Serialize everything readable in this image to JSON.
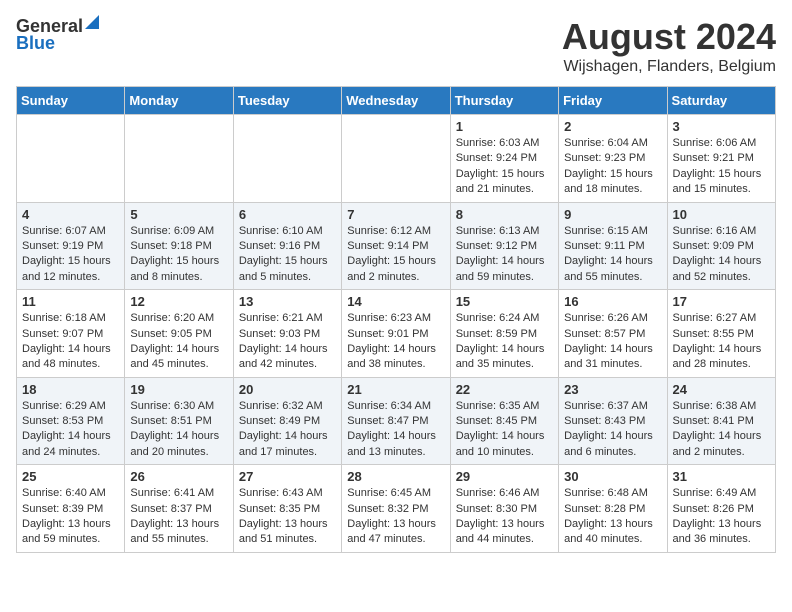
{
  "header": {
    "logo_general": "General",
    "logo_blue": "Blue",
    "month_title": "August 2024",
    "location": "Wijshagen, Flanders, Belgium"
  },
  "days_of_week": [
    "Sunday",
    "Monday",
    "Tuesday",
    "Wednesday",
    "Thursday",
    "Friday",
    "Saturday"
  ],
  "weeks": [
    [
      {
        "day": "",
        "info": ""
      },
      {
        "day": "",
        "info": ""
      },
      {
        "day": "",
        "info": ""
      },
      {
        "day": "",
        "info": ""
      },
      {
        "day": "1",
        "info": "Sunrise: 6:03 AM\nSunset: 9:24 PM\nDaylight: 15 hours and 21 minutes."
      },
      {
        "day": "2",
        "info": "Sunrise: 6:04 AM\nSunset: 9:23 PM\nDaylight: 15 hours and 18 minutes."
      },
      {
        "day": "3",
        "info": "Sunrise: 6:06 AM\nSunset: 9:21 PM\nDaylight: 15 hours and 15 minutes."
      }
    ],
    [
      {
        "day": "4",
        "info": "Sunrise: 6:07 AM\nSunset: 9:19 PM\nDaylight: 15 hours and 12 minutes."
      },
      {
        "day": "5",
        "info": "Sunrise: 6:09 AM\nSunset: 9:18 PM\nDaylight: 15 hours and 8 minutes."
      },
      {
        "day": "6",
        "info": "Sunrise: 6:10 AM\nSunset: 9:16 PM\nDaylight: 15 hours and 5 minutes."
      },
      {
        "day": "7",
        "info": "Sunrise: 6:12 AM\nSunset: 9:14 PM\nDaylight: 15 hours and 2 minutes."
      },
      {
        "day": "8",
        "info": "Sunrise: 6:13 AM\nSunset: 9:12 PM\nDaylight: 14 hours and 59 minutes."
      },
      {
        "day": "9",
        "info": "Sunrise: 6:15 AM\nSunset: 9:11 PM\nDaylight: 14 hours and 55 minutes."
      },
      {
        "day": "10",
        "info": "Sunrise: 6:16 AM\nSunset: 9:09 PM\nDaylight: 14 hours and 52 minutes."
      }
    ],
    [
      {
        "day": "11",
        "info": "Sunrise: 6:18 AM\nSunset: 9:07 PM\nDaylight: 14 hours and 48 minutes."
      },
      {
        "day": "12",
        "info": "Sunrise: 6:20 AM\nSunset: 9:05 PM\nDaylight: 14 hours and 45 minutes."
      },
      {
        "day": "13",
        "info": "Sunrise: 6:21 AM\nSunset: 9:03 PM\nDaylight: 14 hours and 42 minutes."
      },
      {
        "day": "14",
        "info": "Sunrise: 6:23 AM\nSunset: 9:01 PM\nDaylight: 14 hours and 38 minutes."
      },
      {
        "day": "15",
        "info": "Sunrise: 6:24 AM\nSunset: 8:59 PM\nDaylight: 14 hours and 35 minutes."
      },
      {
        "day": "16",
        "info": "Sunrise: 6:26 AM\nSunset: 8:57 PM\nDaylight: 14 hours and 31 minutes."
      },
      {
        "day": "17",
        "info": "Sunrise: 6:27 AM\nSunset: 8:55 PM\nDaylight: 14 hours and 28 minutes."
      }
    ],
    [
      {
        "day": "18",
        "info": "Sunrise: 6:29 AM\nSunset: 8:53 PM\nDaylight: 14 hours and 24 minutes."
      },
      {
        "day": "19",
        "info": "Sunrise: 6:30 AM\nSunset: 8:51 PM\nDaylight: 14 hours and 20 minutes."
      },
      {
        "day": "20",
        "info": "Sunrise: 6:32 AM\nSunset: 8:49 PM\nDaylight: 14 hours and 17 minutes."
      },
      {
        "day": "21",
        "info": "Sunrise: 6:34 AM\nSunset: 8:47 PM\nDaylight: 14 hours and 13 minutes."
      },
      {
        "day": "22",
        "info": "Sunrise: 6:35 AM\nSunset: 8:45 PM\nDaylight: 14 hours and 10 minutes."
      },
      {
        "day": "23",
        "info": "Sunrise: 6:37 AM\nSunset: 8:43 PM\nDaylight: 14 hours and 6 minutes."
      },
      {
        "day": "24",
        "info": "Sunrise: 6:38 AM\nSunset: 8:41 PM\nDaylight: 14 hours and 2 minutes."
      }
    ],
    [
      {
        "day": "25",
        "info": "Sunrise: 6:40 AM\nSunset: 8:39 PM\nDaylight: 13 hours and 59 minutes."
      },
      {
        "day": "26",
        "info": "Sunrise: 6:41 AM\nSunset: 8:37 PM\nDaylight: 13 hours and 55 minutes."
      },
      {
        "day": "27",
        "info": "Sunrise: 6:43 AM\nSunset: 8:35 PM\nDaylight: 13 hours and 51 minutes."
      },
      {
        "day": "28",
        "info": "Sunrise: 6:45 AM\nSunset: 8:32 PM\nDaylight: 13 hours and 47 minutes."
      },
      {
        "day": "29",
        "info": "Sunrise: 6:46 AM\nSunset: 8:30 PM\nDaylight: 13 hours and 44 minutes."
      },
      {
        "day": "30",
        "info": "Sunrise: 6:48 AM\nSunset: 8:28 PM\nDaylight: 13 hours and 40 minutes."
      },
      {
        "day": "31",
        "info": "Sunrise: 6:49 AM\nSunset: 8:26 PM\nDaylight: 13 hours and 36 minutes."
      }
    ]
  ]
}
